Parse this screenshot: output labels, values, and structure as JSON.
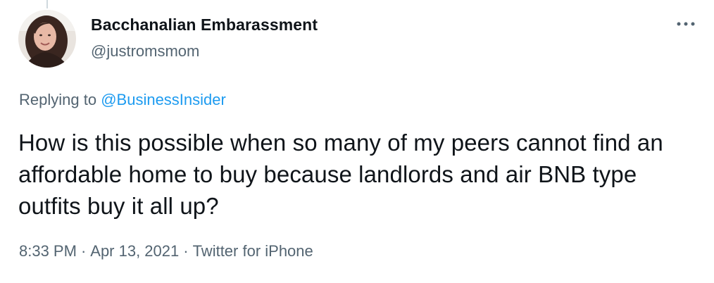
{
  "author": {
    "display_name": "Bacchanalian Embarassment",
    "handle": "@justromsmom"
  },
  "reply_context": {
    "prefix": "Replying to",
    "mention": "@BusinessInsider"
  },
  "tweet": {
    "text": "How is this possible when so many of my peers cannot find an affordable home to buy because landlords and air BNB type outfits buy it all up?"
  },
  "meta": {
    "time": "8:33 PM",
    "separator": "·",
    "date": "Apr 13, 2021",
    "client": "Twitter for iPhone"
  },
  "icons": {
    "more": "more-options-icon"
  },
  "colors": {
    "text_primary": "#0f1419",
    "text_secondary": "#536471",
    "accent": "#1d9bf0"
  }
}
